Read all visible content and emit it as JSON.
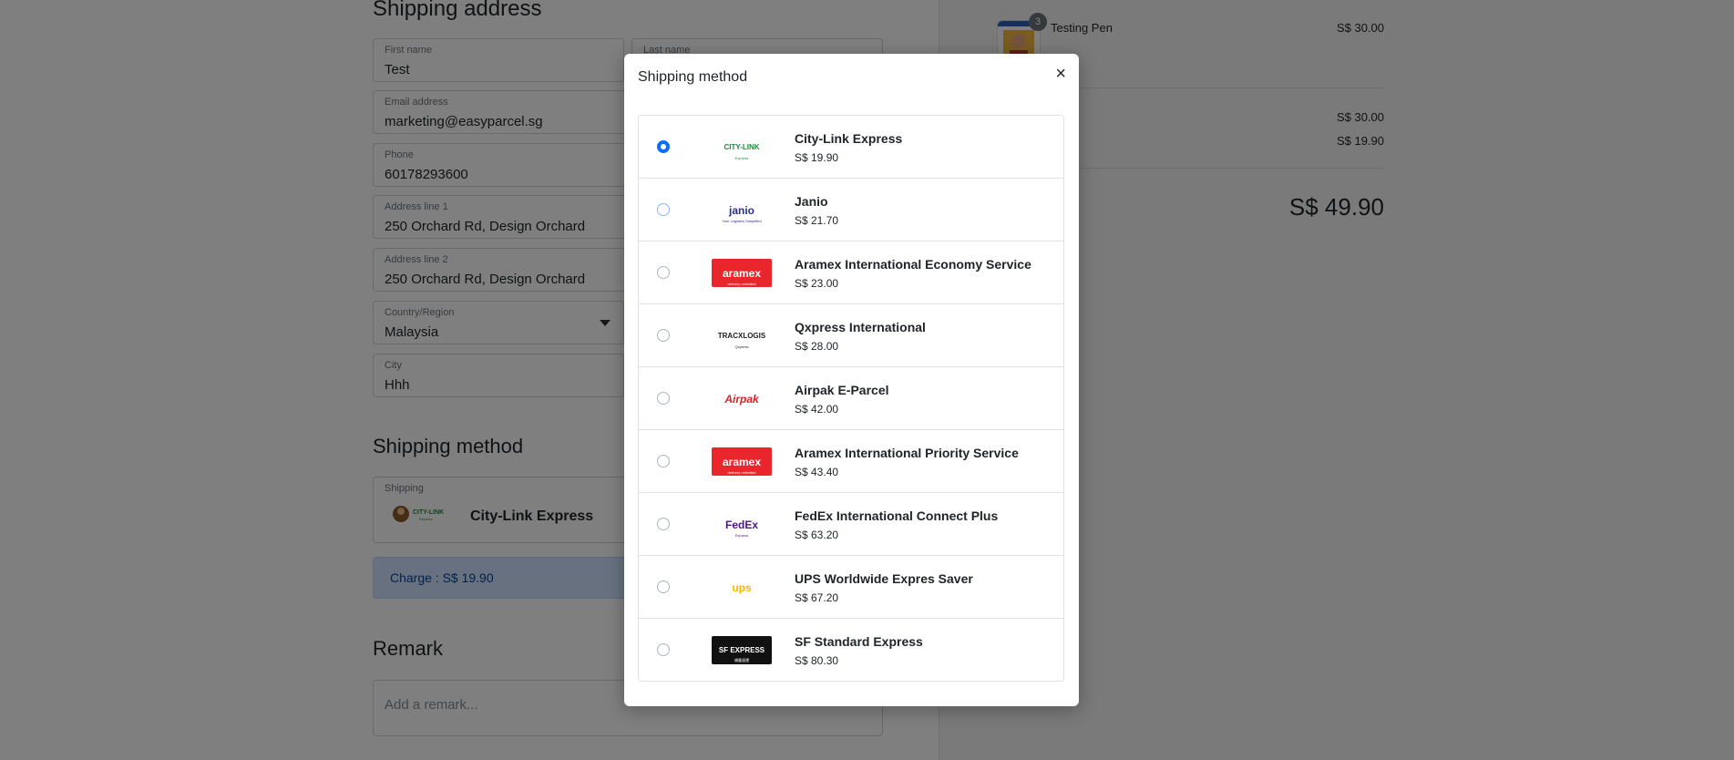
{
  "form": {
    "shipping_address_heading": "Shipping address",
    "first_name": {
      "label": "First name",
      "value": "Test"
    },
    "last_name": {
      "label": "Last name",
      "value": ""
    },
    "email": {
      "label": "Email address",
      "value": "marketing@easyparcel.sg"
    },
    "phone": {
      "label": "Phone",
      "value": "60178293600"
    },
    "address1": {
      "label": "Address line 1",
      "value": "250 Orchard Rd, Design Orchard"
    },
    "address2": {
      "label": "Address line 2",
      "value": "250 Orchard Rd, Design Orchard"
    },
    "country": {
      "label": "Country/Region",
      "value": "Malaysia"
    },
    "city": {
      "label": "City",
      "value": "Hhh"
    },
    "shipping_method_heading": "Shipping method",
    "shipping": {
      "label": "Shipping",
      "value": "City-Link Express",
      "logo_text": "CITY-LINK",
      "logo_sub": "Express"
    },
    "charge": "Charge : S$ 19.90",
    "remark_heading": "Remark",
    "remark_placeholder": "Add a remark..."
  },
  "summary": {
    "item_name": "Testing Pen",
    "item_qty": "3",
    "item_price": "S$ 30.00",
    "subtotal": "S$ 30.00",
    "shipping": "S$ 19.90",
    "total": "S$ 49.90"
  },
  "modal": {
    "title": "Shipping method",
    "close": "×",
    "options": [
      {
        "name": "City-Link Express",
        "price": "S$ 19.90",
        "logo_text": "CITY-LINK",
        "logo_sub": "Express",
        "logo_bg": "#ffffff",
        "logo_color": "#1a8c3a",
        "selected": true
      },
      {
        "name": "Janio",
        "price": "S$ 21.70",
        "logo_text": "janio",
        "logo_sub": "Your Logistics Simplified",
        "logo_bg": "#ffffff",
        "logo_color": "#2b2f8f",
        "selected": false
      },
      {
        "name": "Aramex International Economy Service",
        "price": "S$ 23.00",
        "logo_text": "aramex",
        "logo_sub": "delivery unlimited",
        "logo_bg": "#e8262b",
        "logo_color": "#ffffff",
        "selected": false
      },
      {
        "name": "Qxpress International",
        "price": "S$ 28.00",
        "logo_text": "TRACXLOGIS",
        "logo_sub": "Qxpress",
        "logo_bg": "#ffffff",
        "logo_color": "#1d1d1d",
        "selected": false
      },
      {
        "name": "Airpak E-Parcel",
        "price": "S$ 42.00",
        "logo_text": "Airpak",
        "logo_sub": "",
        "logo_bg": "#ffffff",
        "logo_color": "#d8232a",
        "selected": false
      },
      {
        "name": "Aramex International Priority Service",
        "price": "S$ 43.40",
        "logo_text": "aramex",
        "logo_sub": "delivery unlimited",
        "logo_bg": "#e8262b",
        "logo_color": "#ffffff",
        "selected": false
      },
      {
        "name": "FedEx International Connect Plus",
        "price": "S$ 63.20",
        "logo_text": "FedEx",
        "logo_sub": "Express",
        "logo_bg": "#ffffff",
        "logo_color": "#4d148c",
        "selected": false
      },
      {
        "name": "UPS Worldwide Expres Saver",
        "price": "S$ 67.20",
        "logo_text": "ups",
        "logo_sub": "",
        "logo_bg": "#ffffff",
        "logo_color": "#ffb500",
        "selected": false
      },
      {
        "name": "SF Standard Express",
        "price": "S$ 80.30",
        "logo_text": "SF EXPRESS",
        "logo_sub": "順豐速運",
        "logo_bg": "#111111",
        "logo_color": "#ffffff",
        "selected": false
      }
    ]
  },
  "colors": {
    "accent": "#0d6efd",
    "backdrop": "rgba(0,0,0,0.5)",
    "charge_bg": "#cfe2ff"
  },
  "icons": {
    "close": "close-icon",
    "select": "chevron-down-icon"
  }
}
